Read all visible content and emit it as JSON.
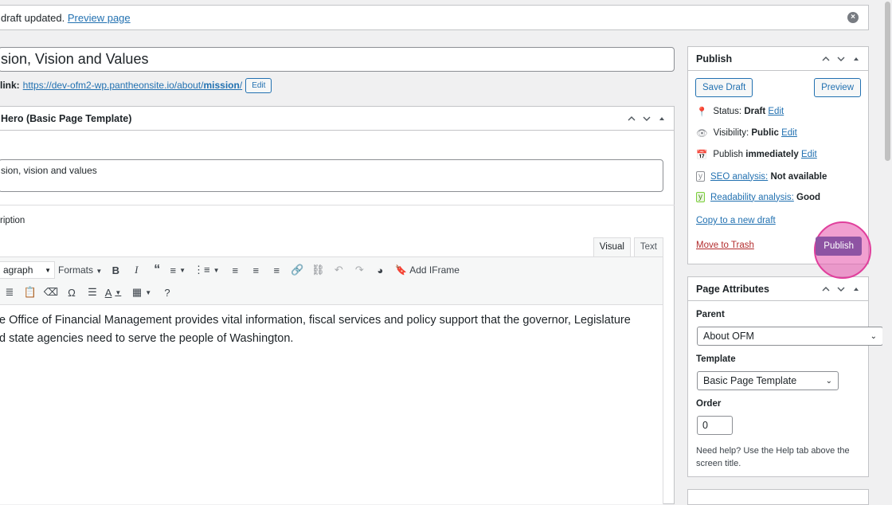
{
  "notice": {
    "text": "draft updated.",
    "link": "Preview page"
  },
  "title": {
    "value": "sion, Vision and Values"
  },
  "permalink": {
    "label": "link:",
    "url_prefix": "https://dev-ofm2-wp.pantheonsite.io/about/",
    "url_slug": "mission",
    "url_suffix": "/",
    "edit_label": "Edit"
  },
  "hero_box": {
    "title": "Hero (Basic Page Template)",
    "subheading_value": "sion, vision and values",
    "description_label": "ription"
  },
  "editor": {
    "tab_visual": "Visual",
    "tab_text": "Text",
    "format_select": "agraph",
    "formats_label": "Formats",
    "add_iframe_label": "Add IFrame",
    "content_line1": "e Office of Financial Management provides vital information, fiscal services and policy support that the governor, Legislature",
    "content_line2": "d state agencies need to serve the people of Washington."
  },
  "publish": {
    "title": "Publish",
    "save_draft": "Save Draft",
    "preview": "Preview",
    "status_label": "Status:",
    "status_value": "Draft",
    "status_edit": "Edit",
    "visibility_label": "Visibility:",
    "visibility_value": "Public",
    "visibility_edit": "Edit",
    "publish_label": "Publish",
    "publish_value": "immediately",
    "publish_edit": "Edit",
    "seo_link": "SEO analysis:",
    "seo_value": "Not available",
    "readability_link": "Readability analysis:",
    "readability_value": "Good",
    "copy_draft": "Copy to a new draft",
    "trash": "Move to Trash",
    "publish_button": "Publish"
  },
  "page_attributes": {
    "title": "Page Attributes",
    "parent_label": "Parent",
    "parent_value": "About OFM",
    "template_label": "Template",
    "template_value": "Basic Page Template",
    "order_label": "Order",
    "order_value": "0",
    "help_text": "Need help? Use the Help tab above the screen title."
  },
  "colors": {
    "link": "#2271b1",
    "publish_btn": "#8e53a3",
    "highlight": "#e03f9c",
    "trash": "#b32d2e",
    "yoast_good": "#7ad03a"
  }
}
